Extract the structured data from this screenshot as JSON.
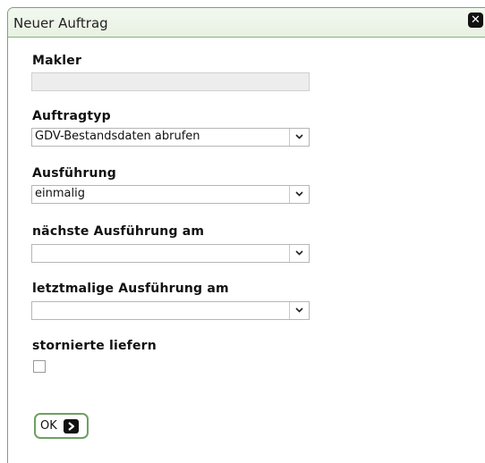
{
  "dialog": {
    "title": "Neuer Auftrag",
    "close_icon": "close-icon",
    "fields": {
      "makler": {
        "label": "Makler",
        "value": ""
      },
      "auftragtyp": {
        "label": "Auftragtyp",
        "selected": "GDV-Bestandsdaten abrufen"
      },
      "ausfuehrung": {
        "label": "Ausführung",
        "selected": "einmalig"
      },
      "naechste_ausfuehrung": {
        "label": "nächste Ausführung am",
        "selected": ""
      },
      "letztmalige_ausfuehrung": {
        "label": "letztmalige Ausführung am",
        "selected": ""
      },
      "stornierte_liefern": {
        "label": "stornierte liefern",
        "checked": false
      }
    },
    "ok_button": {
      "label": "OK",
      "icon": "arrow-right-icon"
    }
  },
  "colors": {
    "accent_border": "#76a76f",
    "title_bg": "#eef5ea",
    "button_border": "#6fa062"
  }
}
